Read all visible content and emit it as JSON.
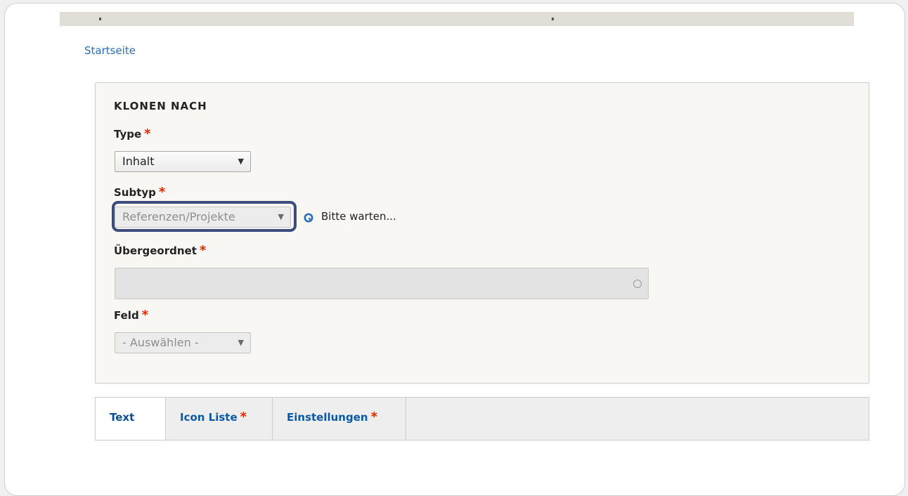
{
  "breadcrumb": {
    "home": "Startseite"
  },
  "form": {
    "legend": "KLONEN NACH",
    "type_label": "Type",
    "type_value": "Inhalt",
    "subtype_label": "Subtyp",
    "subtype_value": "Referenzen/Projekte",
    "throbber_text": "Bitte warten...",
    "parent_label": "Übergeordnet",
    "parent_value": "",
    "field_label": "Feld",
    "field_value": "- Auswählen -",
    "required_marker": "*"
  },
  "tabs": [
    {
      "label": "Text",
      "required": ""
    },
    {
      "label": "Icon Liste",
      "required": "*"
    },
    {
      "label": "Einstellungen",
      "required": "*"
    }
  ],
  "colors": {
    "link": "#2a6fb6",
    "required": "#e32700",
    "highlight": "#3c4c7d"
  },
  "icons": {
    "throbber": "loading-spinner-icon",
    "caret": "caret-down-icon",
    "autocomplete": "autocomplete-circle-icon"
  }
}
